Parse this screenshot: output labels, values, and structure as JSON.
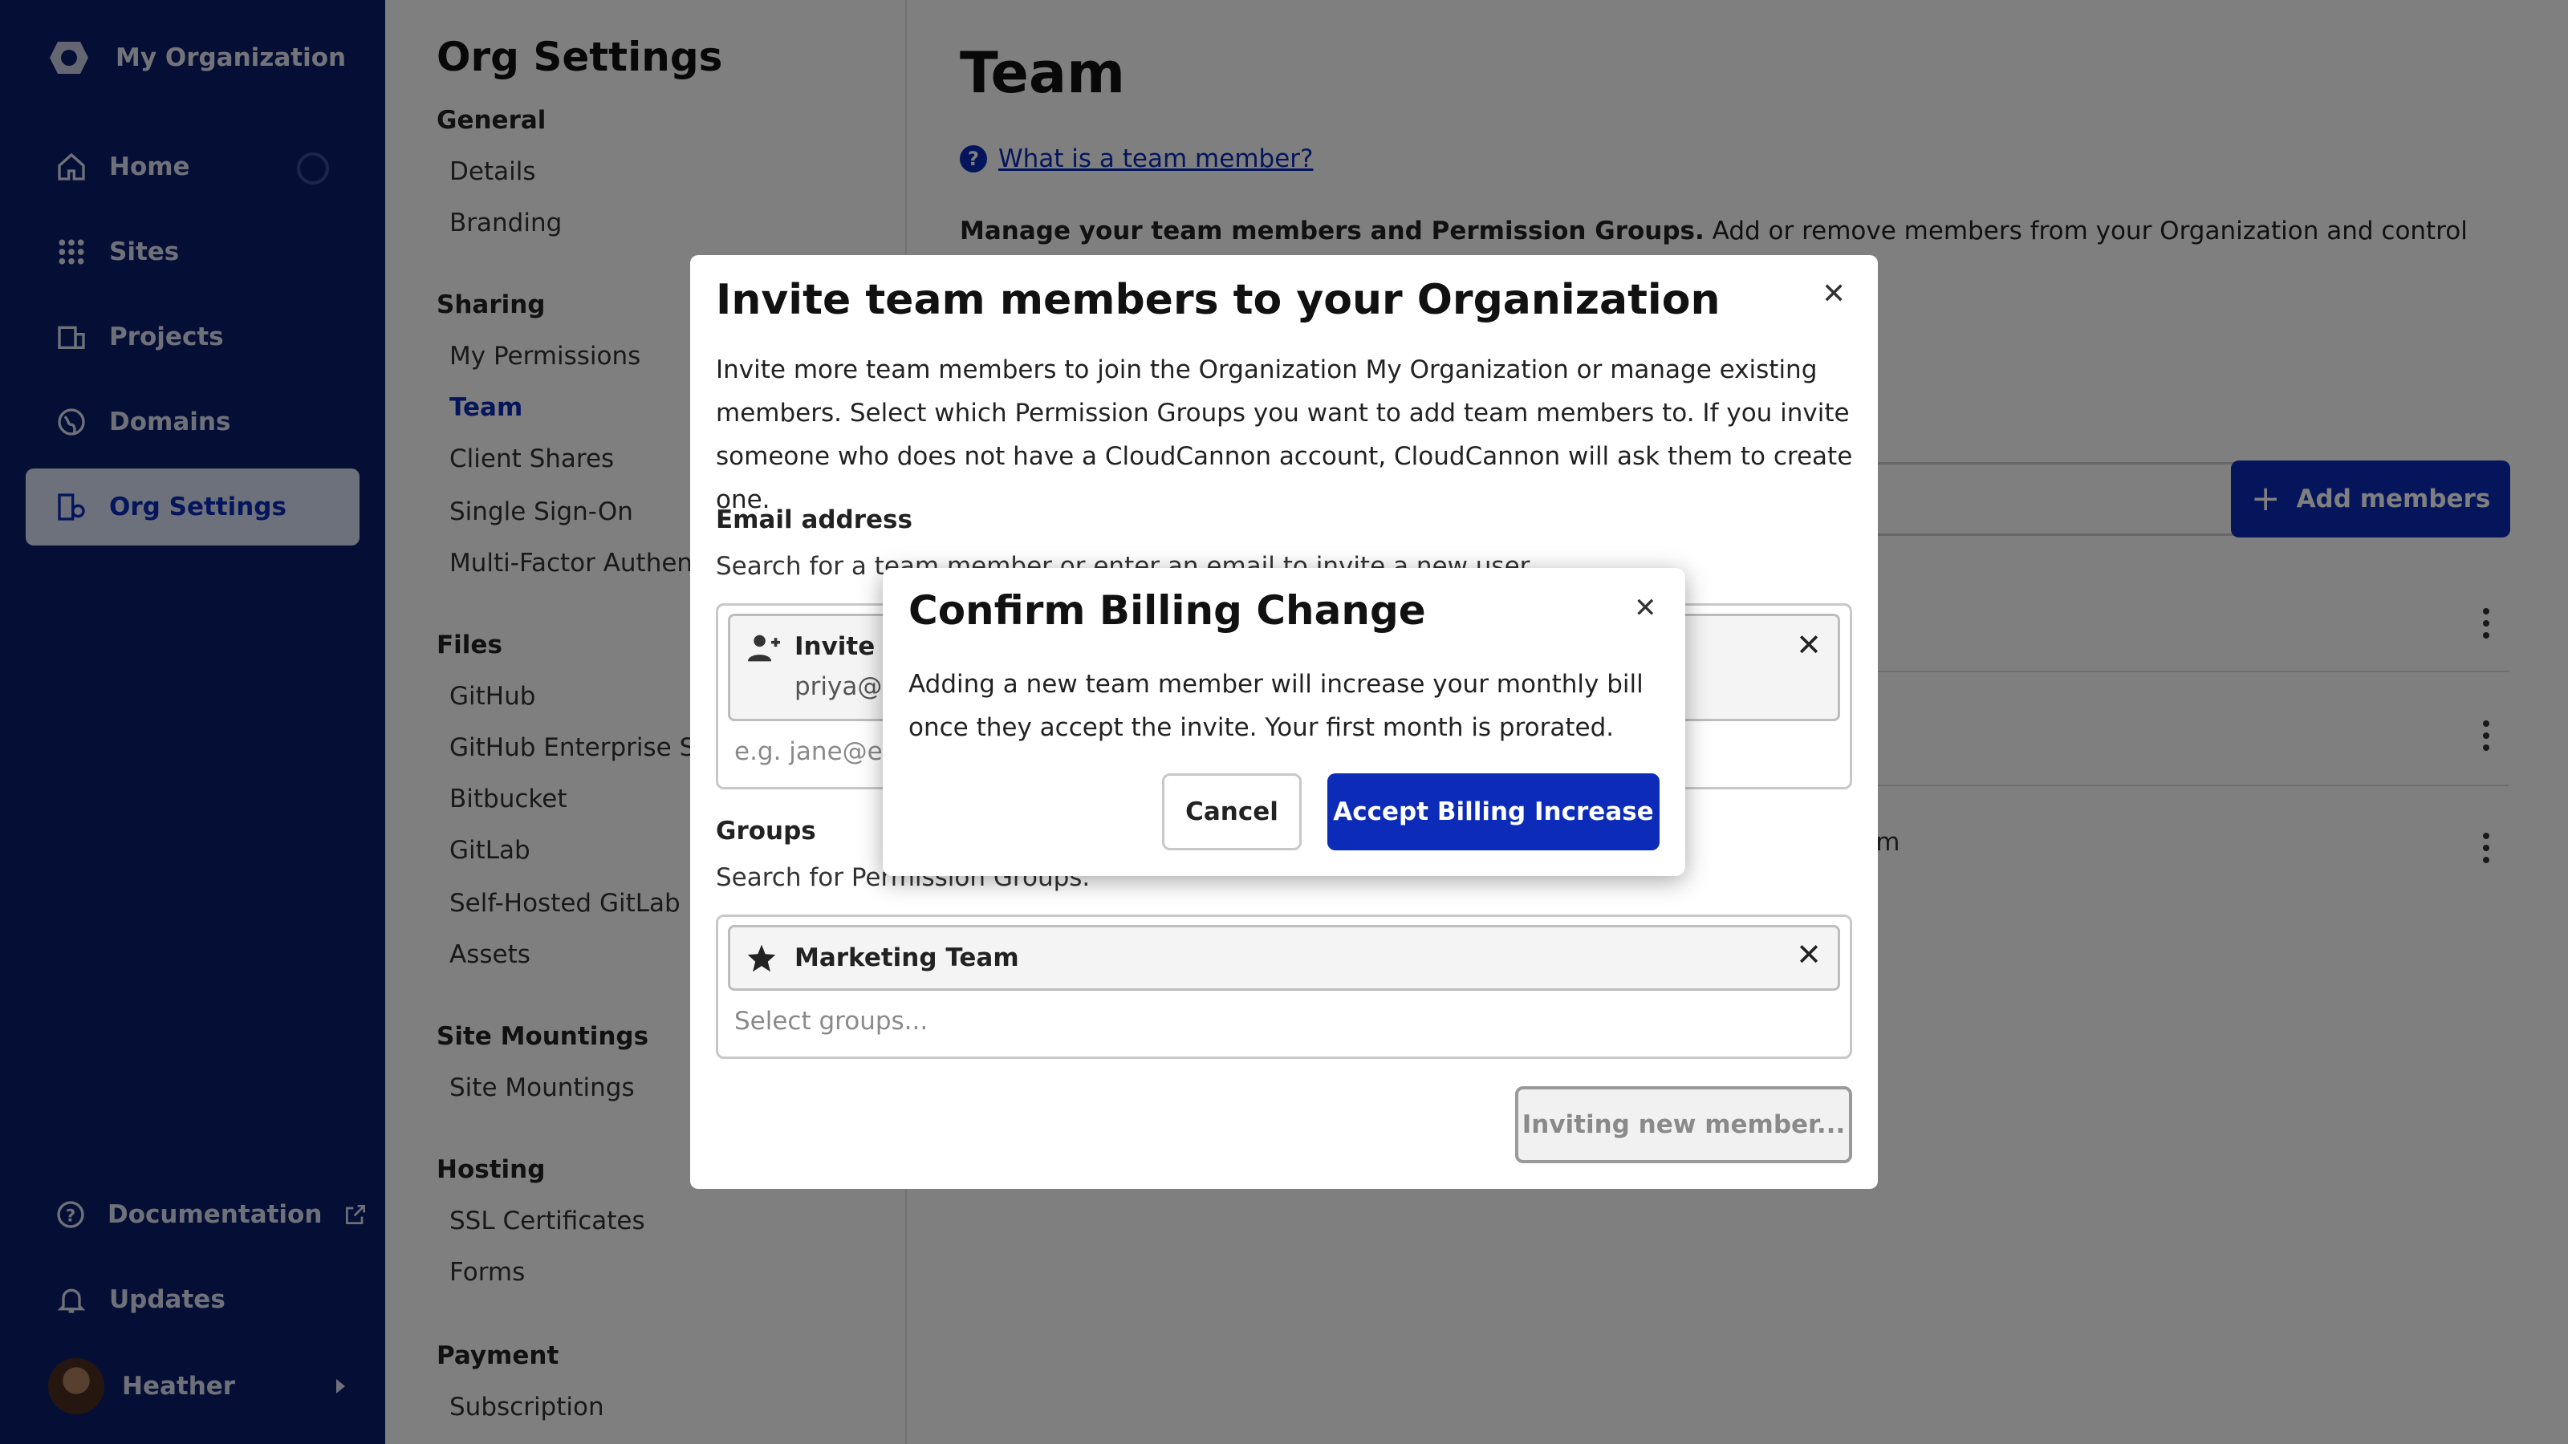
{
  "nav": {
    "org_name": "My Organization",
    "items": [
      {
        "label": "Home",
        "icon": "home-icon"
      },
      {
        "label": "Sites",
        "icon": "grid-icon"
      },
      {
        "label": "Projects",
        "icon": "projects-icon"
      },
      {
        "label": "Domains",
        "icon": "globe-icon"
      },
      {
        "label": "Org Settings",
        "icon": "org-settings-icon"
      }
    ],
    "bottom": [
      {
        "label": "Documentation",
        "icon": "help-circle-icon",
        "extra_icon": "external-link-icon"
      },
      {
        "label": "Updates",
        "icon": "bell-icon"
      }
    ],
    "user": {
      "name": "Heather"
    }
  },
  "settings": {
    "title": "Org Settings",
    "sections": [
      {
        "heading": "General",
        "items": [
          "Details",
          "Branding"
        ]
      },
      {
        "heading": "Sharing",
        "items": [
          "My Permissions",
          "Team",
          "Client Shares",
          "Single Sign-On",
          "Multi-Factor Authent"
        ]
      },
      {
        "heading": "Files",
        "items": [
          "GitHub",
          "GitHub Enterprise Se",
          "Bitbucket",
          "GitLab",
          "Self-Hosted GitLab",
          "Assets"
        ]
      },
      {
        "heading": "Site Mountings",
        "items": [
          "Site Mountings"
        ]
      },
      {
        "heading": "Hosting",
        "items": [
          "SSL Certificates",
          "Forms"
        ]
      },
      {
        "heading": "Payment",
        "items": [
          "Subscription"
        ]
      }
    ],
    "active_item": "Team"
  },
  "main": {
    "title": "Team",
    "help_link": "What is a team member?",
    "intro_bold": "Manage your team members and Permission Groups.",
    "intro_rest": " Add or remove members from your Organization and control which",
    "add_button": "Add members",
    "row_text": "g Team"
  },
  "invite_modal": {
    "title": "Invite team members to your Organization",
    "description": "Invite more team members to join the Organization My Organization or manage existing members. Select which Permission Groups you want to add team members to. If you invite someone who does not have a CloudCannon account, CloudCannon will ask them to create one.",
    "email_label": "Email address",
    "email_hint": "Search for a team member or enter an email to invite a new user",
    "chip_title": "Invite",
    "chip_sub": "priya@e",
    "email_placeholder": "e.g. jane@ex",
    "groups_label": "Groups",
    "groups_hint": "Search for Permission Groups.",
    "group_chip": "Marketing Team",
    "groups_placeholder": "Select groups...",
    "submit": "Inviting new member..."
  },
  "confirm_dialog": {
    "title": "Confirm Billing Change",
    "body": "Adding a new team member will increase your monthly bill once they accept the invite. Your first month is prorated.",
    "cancel": "Cancel",
    "accept": "Accept Billing Increase"
  },
  "colors": {
    "nav_bg": "#0b1f6b",
    "accent": "#0b2bb8",
    "overlay": "rgba(0,0,0,0.5)"
  }
}
